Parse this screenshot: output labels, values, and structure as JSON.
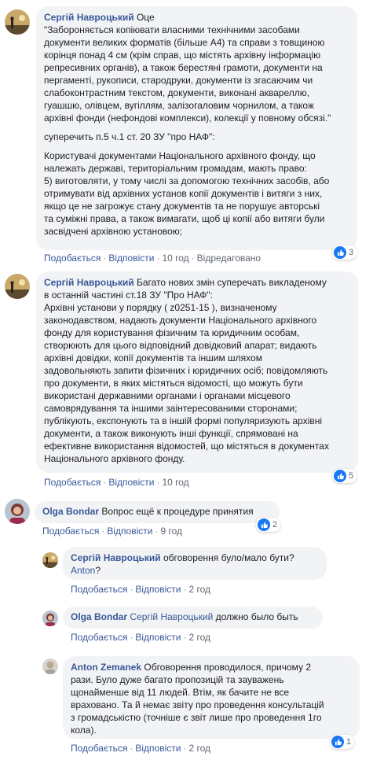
{
  "comments": [
    {
      "author": "Сергій Навроцький",
      "lead": "Оце",
      "paragraphs": [
        "\"Забороняється копіювати власними технічними засобами\nдокументи великих форматів (більше А4) та справи з товщиною\nкорінця понад 4 см (крім справ, що містять архівну інформацію\nрепресивних органів), а також берестяні грамоти, документи на\nпергаменті, рукописи, стародруки, документи із згасаючим чи\nслабоконтрастним текстом, документи, виконані аквареллю,\nгуашшю, олівцем, вугіллям, залізогаловим чорнилом, а також\nархівні фонди (нефондові комплекси), колекції у повному обсязі.\"",
        "суперечить п.5 ч.1 ст. 20 ЗУ \"про НАФ\":",
        "Користувачі документами Національного архівного фонду, що\nналежать державі, територіальним громадам, мають право:\n5) виготовляти, у тому числі за допомогою технічних засобів, або\nотримувати від архівних установ копії документів і витяги з них,\nякщо це не загрожує стану документів та не порушує авторські\nта суміжні права, а також вимагати, щоб ці копії або витяги були\nзасвідчені архівною установою;"
      ],
      "like": "Подобається",
      "reply": "Відповісти",
      "time": "10 год",
      "edited": "Відредаговано",
      "reactions": "3"
    },
    {
      "author": "Сергій Навроцький",
      "lead": "Багато нових змін суперечать викладеному\nв останній частині ст.18 ЗУ \"Про НАФ\":",
      "paragraphs": [
        "Архівні установи у порядку ( z0251-15 ), визначеному\nзаконодавством, надають документи Національного архівного\nфонду для користування фізичним та юридичним особам,\nстворюють для цього відповідний довідковий апарат; видають\nархівні довідки, копії документів та іншим шляхом\nзадовольняють запити фізичних і юридичних осіб; повідомляють\nпро документи, в яких містяться відомості, що можуть бути\nвикористані державними органами і органами місцевого\nсамоврядування та іншими заінтересованими сторонами;\nпублікують, експонують та в іншій формі популяризують архівні\nдокументи, а також виконують інші функції, спрямовані на\nефективне використання відомостей, що містяться в документах\nНаціонального архівного фонду."
      ],
      "like": "Подобається",
      "reply": "Відповісти",
      "time": "10 год",
      "reactions": "5"
    },
    {
      "author": "Olga Bondar",
      "lead": "Вопрос ещё к процедуре принятия",
      "like": "Подобається",
      "reply": "Відповісти",
      "time": "9 год",
      "reactions": "2"
    }
  ],
  "replies": [
    {
      "author": "Сергій Навроцький",
      "text": "обговорення було/мало бути?",
      "mention_line2": "Anton",
      "tail_line2": "?",
      "like": "Подобається",
      "reply": "Відповісти",
      "time": "2 год"
    },
    {
      "author": "Olga Bondar",
      "mention": "Сергій Навроцький",
      "text": "должно было быть",
      "like": "Подобається",
      "reply": "Відповісти",
      "time": "2 год"
    },
    {
      "author": "Anton Zemanek",
      "text": "Обговорення проводилося, причому 2\nрази. Було дуже багато пропозицій та зауважень\nщонайменше від 11 людей. Втім, як бачите не все\nвраховано. Та й немає звіту про проведення консультацій\nз громадськістю (точніше є звіт лише про проведення 1го\nкола).",
      "like": "Подобається",
      "reply": "Відповісти",
      "time": "2 год",
      "reactions": "1"
    }
  ],
  "colors": {
    "bubble": "#f2f3f5",
    "link": "#385898",
    "like": "#1877f2"
  }
}
